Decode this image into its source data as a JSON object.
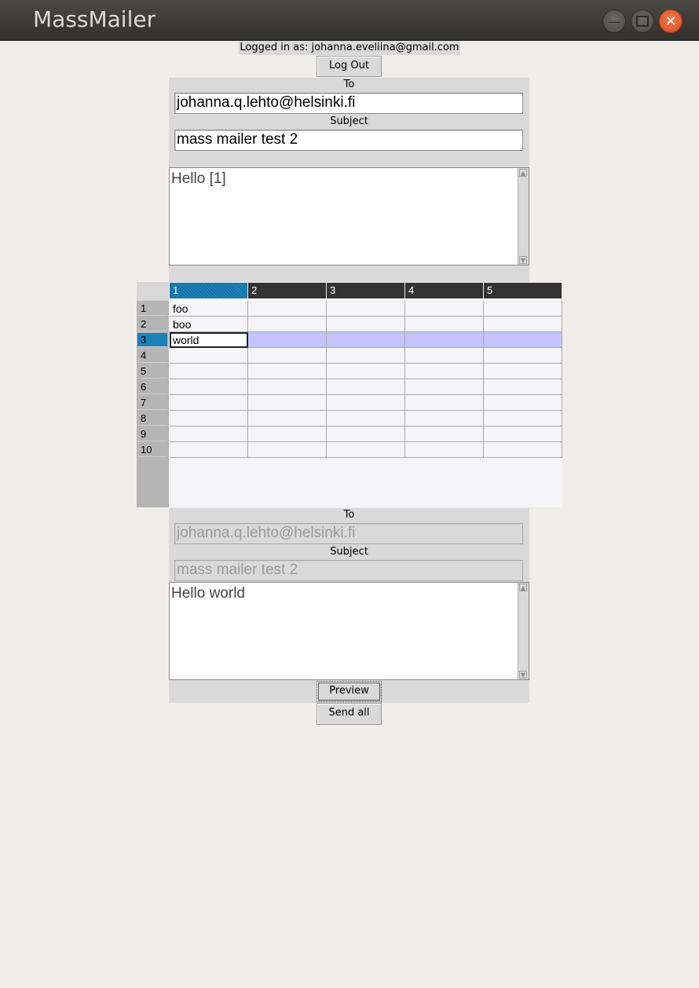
{
  "window": {
    "title": "MassMailer"
  },
  "header": {
    "logged_in": "Logged in as: johanna.eveliina@gmail.com",
    "logout_label": "Log Out"
  },
  "template": {
    "to_label": "To",
    "to_value": "johanna.q.lehto@helsinki.fi",
    "subject_label": "Subject",
    "subject_value": "mass mailer test 2",
    "body": "Hello [1]"
  },
  "sheet": {
    "columns": [
      "1",
      "2",
      "3",
      "4",
      "5"
    ],
    "rows": [
      "1",
      "2",
      "3",
      "4",
      "5",
      "6",
      "7",
      "8",
      "9",
      "10"
    ],
    "cells": [
      [
        "foo",
        "",
        "",
        "",
        ""
      ],
      [
        "boo",
        "",
        "",
        "",
        ""
      ],
      [
        "world",
        "",
        "",
        "",
        ""
      ],
      [
        "",
        "",
        "",
        "",
        ""
      ],
      [
        "",
        "",
        "",
        "",
        ""
      ],
      [
        "",
        "",
        "",
        "",
        ""
      ],
      [
        "",
        "",
        "",
        "",
        ""
      ],
      [
        "",
        "",
        "",
        "",
        ""
      ],
      [
        "",
        "",
        "",
        "",
        ""
      ],
      [
        "",
        "",
        "",
        "",
        ""
      ]
    ],
    "selected_row": 3,
    "selected_column": 1
  },
  "preview": {
    "to_label": "To",
    "to_value": "johanna.q.lehto@helsinki.fi",
    "subject_label": "Subject",
    "subject_value": "mass mailer test 2",
    "body": "Hello world"
  },
  "actions": {
    "preview_label": "Preview",
    "send_all_label": "Send all"
  }
}
